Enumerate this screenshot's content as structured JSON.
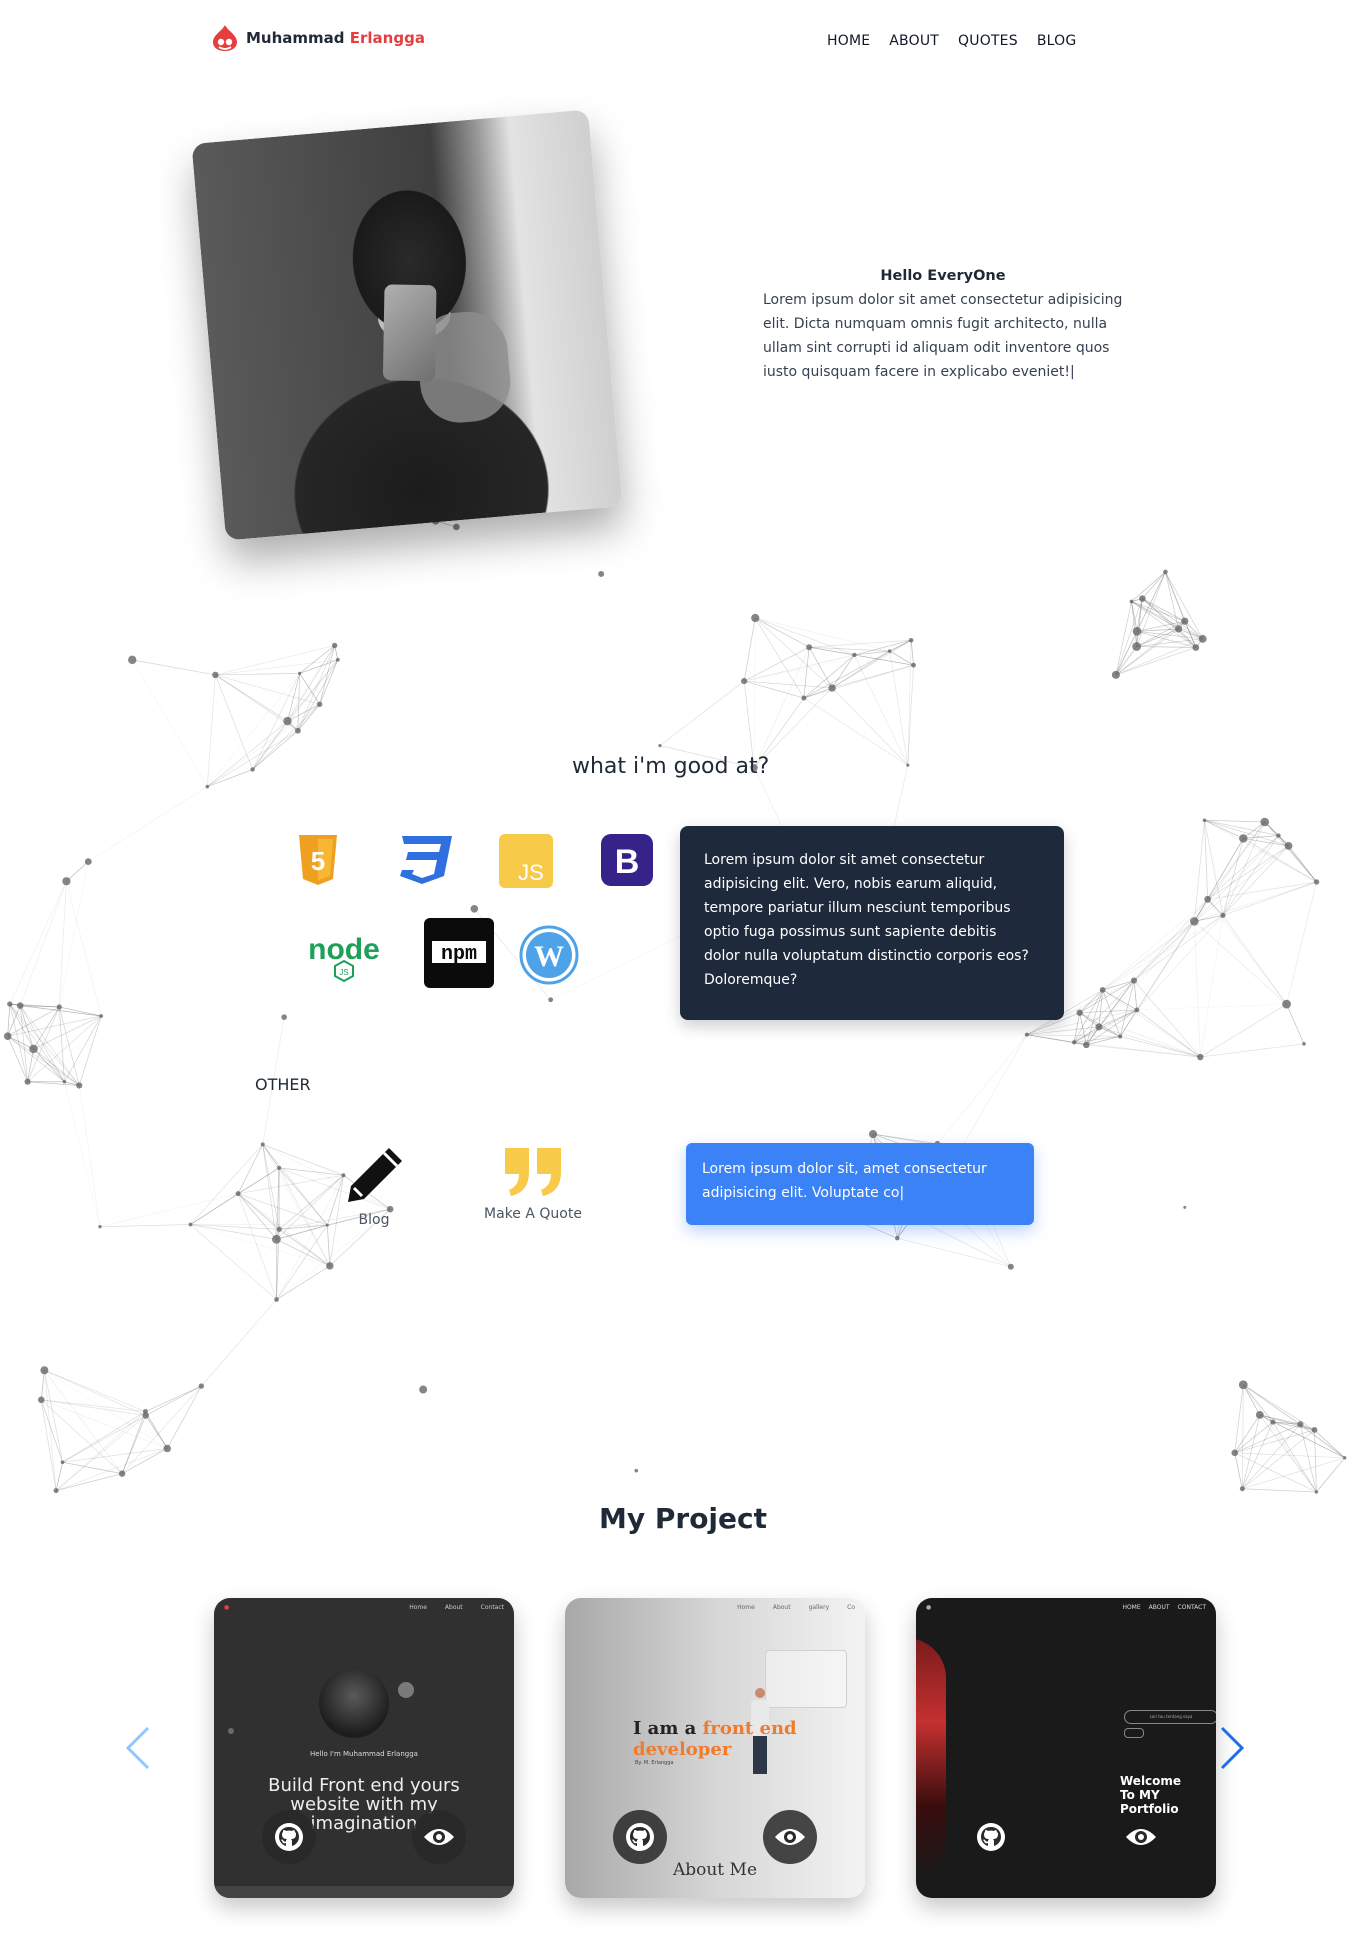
{
  "header": {
    "brand_first": "Muhammad",
    "brand_last": "Erlangga",
    "logo_icon": "drupal-drop-icon",
    "nav": [
      "HOME",
      "ABOUT",
      "QUOTES",
      "BLOG"
    ]
  },
  "profile": {
    "photo_alt": "profile-photo",
    "greeting": "Hello EveryOne",
    "intro": "Lorem ipsum dolor sit amet consectetur adipisicing elit. Dicta numquam omnis fugit architecto, nulla ullam sint corrupti id aliquam odit inventore quos iusto quisquam facere in explicabo eveniet!|"
  },
  "skills": {
    "heading": "what i'm good at?",
    "icons": [
      {
        "name": "html5-icon",
        "label": "5"
      },
      {
        "name": "css3-icon",
        "label": "3"
      },
      {
        "name": "javascript-icon",
        "label": "JS"
      },
      {
        "name": "bootstrap-icon",
        "label": "B"
      },
      {
        "name": "nodejs-icon",
        "label": "node",
        "sub": "JS"
      },
      {
        "name": "npm-icon",
        "label": "npm"
      },
      {
        "name": "wordpress-icon",
        "label": "W"
      }
    ],
    "description": "Lorem ipsum dolor sit amet consectetur adipisicing elit. Vero, nobis earum aliquid, tempore pariatur illum nesciunt temporibus optio fuga possimus sunt sapiente debitis dolor nulla voluptatum distinctio corporis eos? Doloremque?"
  },
  "other": {
    "heading": "OTHER",
    "items": [
      {
        "icon": "pencil-icon",
        "label": "Blog"
      },
      {
        "icon": "quote-icon",
        "label": "Make A Quote"
      }
    ],
    "note": "Lorem ipsum dolor sit, amet consectetur adipisicing elit. Voluptate co|"
  },
  "projects": {
    "heading": "My Project",
    "cards": [
      {
        "nav": [
          "Home",
          "About",
          "Contact"
        ],
        "small_text": "Hello I'm Muhammad Erlangga",
        "headline": "Build Front end yours website with my imagination"
      },
      {
        "nav": [
          "Home",
          "About",
          "gallery",
          "Co"
        ],
        "headline_a": "I am a ",
        "headline_accent": "front end",
        "headline_b": "developer",
        "byline": "By. M. Erlangga",
        "caption": "About Me"
      },
      {
        "nav": [
          "HOME",
          "ABOUT",
          "CONTACT"
        ],
        "pill": "cari tau tentang saya",
        "welcome": "Welcome To MY Portfolio"
      }
    ],
    "prev_icon": "chevron-left-icon",
    "next_icon": "chevron-right-icon",
    "github_icon": "github-icon",
    "view_icon": "eye-icon"
  },
  "colors": {
    "accent_red": "#e53e3e",
    "dark_card": "#1e293b",
    "blue_card": "#3b82f6"
  }
}
